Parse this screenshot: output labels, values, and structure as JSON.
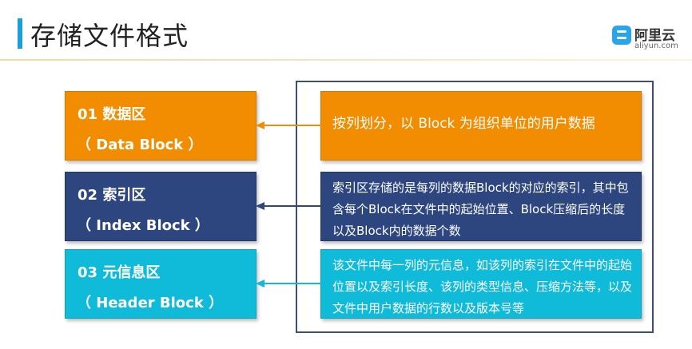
{
  "header": {
    "title": "存储文件格式"
  },
  "logo": {
    "name": "阿里云",
    "url": "aliyun.com"
  },
  "colors": {
    "orange": "#f28c00",
    "navy": "#2e4680",
    "cyan": "#10bbd9",
    "title_accent": "#1aa0d8"
  },
  "sections": [
    {
      "number_title": "01 数据区",
      "subtitle": "（ Data Block ）",
      "description": "按列划分，以 Block 为组织单位的用户数据"
    },
    {
      "number_title": "02 索引区",
      "subtitle": "（ Index Block ）",
      "description": "索引区存储的是每列的数据Block的对应的索引，其中包含每个Block在文件中的起始位置、Block压缩后的长度以及Block内的数据个数"
    },
    {
      "number_title": "03 元信息区",
      "subtitle": "（ Header Block ）",
      "description": "该文件中每一列的元信息，如该列的索引在文件中的起始位置以及索引长度、该列的类型信息、压缩方法等，以及文件中用户数据的行数以及版本号等"
    }
  ]
}
